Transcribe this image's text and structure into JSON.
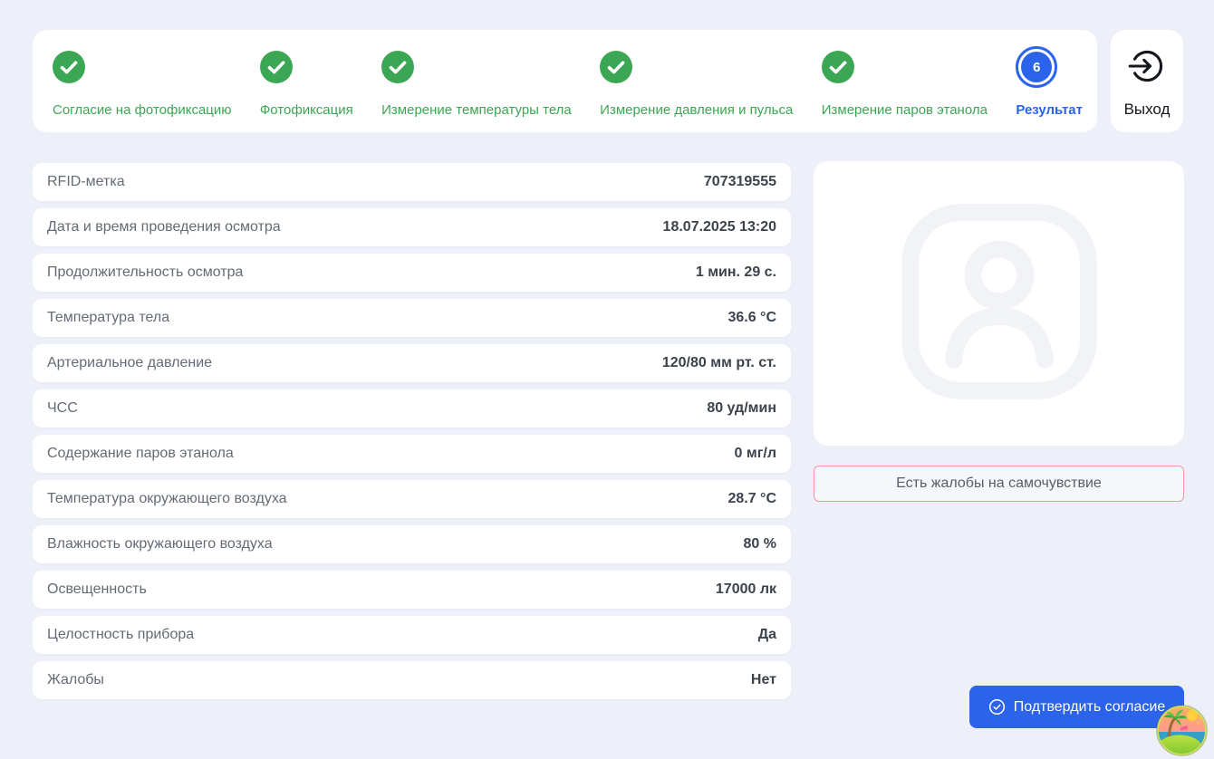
{
  "colors": {
    "background": "#edf0f8",
    "card": "#ffffff",
    "accent_blue": "#2b63eb",
    "success_green": "#3ba653",
    "danger_border": "#f0999f",
    "value_text": "#3c434d",
    "label_text": "#646b75"
  },
  "stepper": {
    "steps": [
      {
        "label": "Согласие на фотофиксацию",
        "state": "done",
        "icon": "check-circle-icon"
      },
      {
        "label": "Фотофиксация",
        "state": "done",
        "icon": "check-circle-icon"
      },
      {
        "label": "Измерение температуры тела",
        "state": "done",
        "icon": "check-circle-icon"
      },
      {
        "label": "Измерение давления и пульса",
        "state": "done",
        "icon": "check-circle-icon"
      },
      {
        "label": "Измерение паров этанола",
        "state": "done",
        "icon": "check-circle-icon"
      },
      {
        "label": "Результат",
        "state": "active",
        "number": "6"
      }
    ]
  },
  "exit": {
    "label": "Выход",
    "icon": "logout-icon"
  },
  "results": {
    "rows": [
      {
        "label": "RFID-метка",
        "value": "707319555"
      },
      {
        "label": "Дата и время проведения осмотра",
        "value": "18.07.2025 13:20"
      },
      {
        "label": "Продолжительность осмотра",
        "value": "1 мин. 29 с."
      },
      {
        "label": "Температура тела",
        "value": "36.6 °C"
      },
      {
        "label": "Артериальное давление",
        "value": "120/80 мм рт. ст."
      },
      {
        "label": "ЧСС",
        "value": "80 уд/мин"
      },
      {
        "label": "Содержание паров этанола",
        "value": "0 мг/л"
      },
      {
        "label": "Температура окружающего воздуха",
        "value": "28.7 °C"
      },
      {
        "label": "Влажность окружающего воздуха",
        "value": "80 %"
      },
      {
        "label": "Освещенность",
        "value": "17000 лк"
      },
      {
        "label": "Целостность прибора",
        "value": "Да"
      },
      {
        "label": "Жалобы",
        "value": "Нет"
      }
    ]
  },
  "photo": {
    "icon": "user-photo-placeholder-icon"
  },
  "complaints_button": {
    "label": "Есть жалобы на самочувствие"
  },
  "confirm_button": {
    "label": "Подтвердить согласие",
    "icon": "check-circle-outline-icon"
  },
  "overlay": {
    "icon": "tropical-island-icon"
  }
}
